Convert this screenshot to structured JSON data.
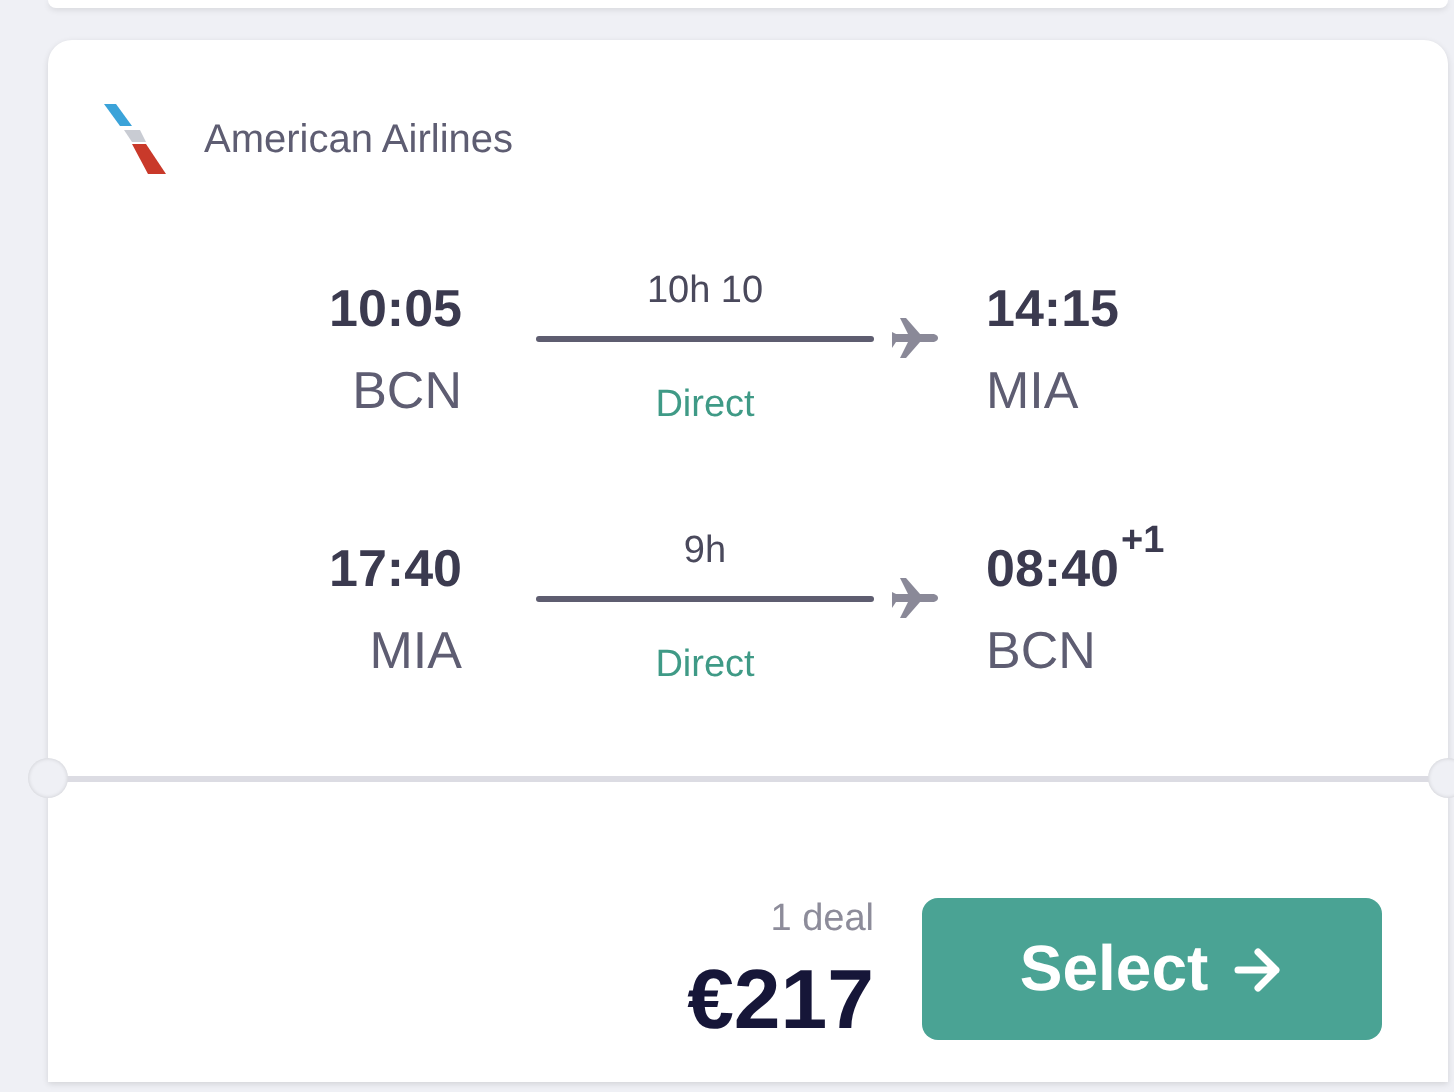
{
  "airline": {
    "name": "American Airlines"
  },
  "legs": [
    {
      "depart_time": "10:05",
      "depart_airport": "BCN",
      "duration": "10h 10",
      "stops": "Direct",
      "arrive_time": "14:15",
      "arrive_airport": "MIA"
    },
    {
      "depart_time": "17:40",
      "depart_airport": "MIA",
      "duration": "9h",
      "stops": "Direct",
      "arrive_time": "08:40",
      "day_offset": "+1",
      "arrive_airport": "BCN"
    }
  ],
  "price": {
    "deals": "1 deal",
    "amount": "€217"
  },
  "button": {
    "label": "Select"
  }
}
